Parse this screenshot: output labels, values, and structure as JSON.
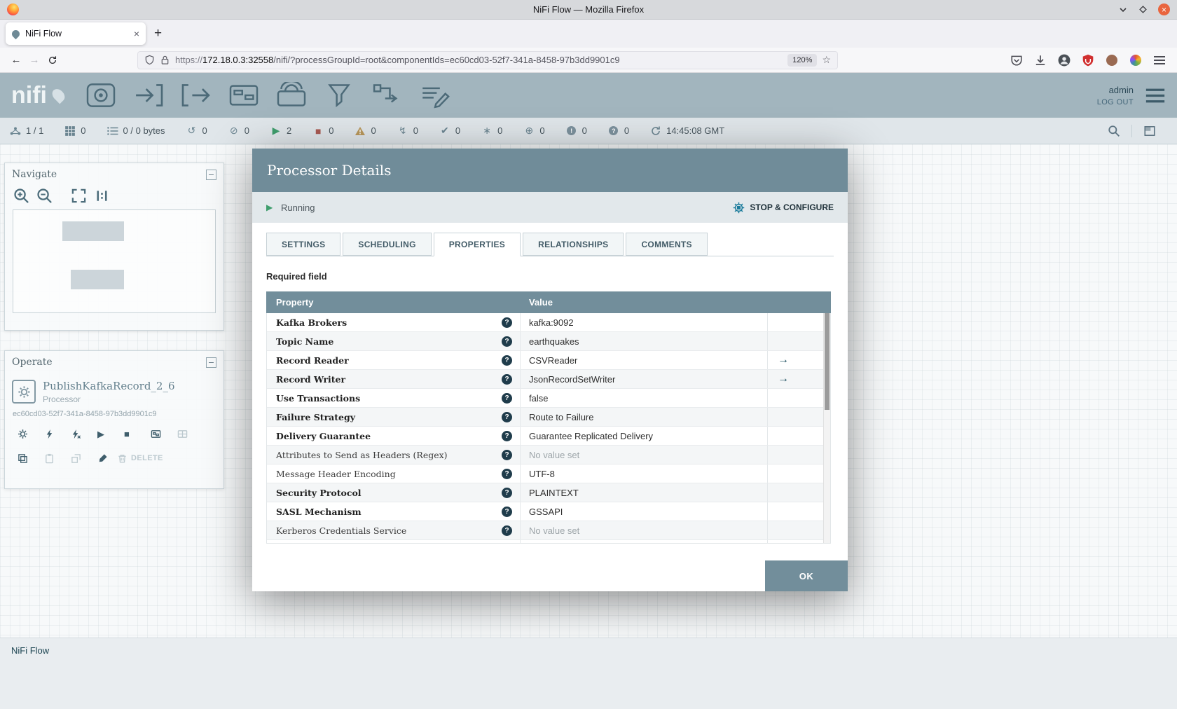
{
  "window": {
    "title": "NiFi Flow — Mozilla Firefox",
    "tab": {
      "title": "NiFi Flow"
    },
    "nav": {
      "urlbar": {
        "scheme": "https://",
        "host": "172.18.0.3:32558",
        "path": "/nifi/?processGroupId=root&componentIds=ec60cd03-52f7-341a-8458-97b3dd9901c9",
        "zoom": "120%"
      },
      "right_icons": [
        "pocket-icon",
        "downloads-icon",
        "account-icon",
        "ublock-icon",
        "extension-avatar-icon",
        "extension-pinwheel-icon",
        "menu-icon"
      ]
    }
  },
  "nifi": {
    "logo_text": "nifi",
    "toolbar": [
      {
        "name": "processor-component",
        "icon": "processor-icon"
      },
      {
        "name": "input-port-component",
        "icon": "input-port-icon"
      },
      {
        "name": "output-port-component",
        "icon": "output-port-icon"
      },
      {
        "name": "process-group-component",
        "icon": "process-group-icon"
      },
      {
        "name": "remote-process-group-component",
        "icon": "remote-process-group-icon"
      },
      {
        "name": "funnel-component",
        "icon": "funnel-icon"
      },
      {
        "name": "template-component",
        "icon": "template-icon"
      },
      {
        "name": "label-component",
        "icon": "label-icon"
      }
    ],
    "user": "admin",
    "logout_label": "LOG OUT",
    "statusbar": {
      "items": [
        {
          "name": "connected-nodes-count",
          "icon": "cluster-icon",
          "value": "1 / 1"
        },
        {
          "name": "active-threads-count",
          "icon": "threads-icon",
          "value": "0"
        },
        {
          "name": "queued-count",
          "icon": "queue-icon",
          "value": "0 / 0 bytes"
        },
        {
          "name": "transmitting-count",
          "icon": "transmitting-icon",
          "value": "0"
        },
        {
          "name": "not-transmitting-count",
          "icon": "not-transmitting-icon",
          "value": "0"
        },
        {
          "name": "running-count",
          "icon": "running-icon",
          "value": "2"
        },
        {
          "name": "stopped-count",
          "icon": "stopped-icon",
          "value": "0"
        },
        {
          "name": "invalid-count",
          "icon": "invalid-icon",
          "value": "0"
        },
        {
          "name": "disabled-count",
          "icon": "disabled-icon",
          "value": "0"
        },
        {
          "name": "up-to-date-count",
          "icon": "up-to-date-icon",
          "value": "0"
        },
        {
          "name": "locally-modified-count",
          "icon": "locally-modified-icon",
          "value": "0"
        },
        {
          "name": "stale-count",
          "icon": "stale-icon",
          "value": "0"
        },
        {
          "name": "locally-modified-stale-count",
          "icon": "locally-modified-stale-icon",
          "value": "0"
        },
        {
          "name": "sync-failure-count",
          "icon": "sync-failure-icon",
          "value": "0"
        },
        {
          "name": "last-refresh-time",
          "icon": "refresh-icon",
          "value": "14:45:08 GMT"
        }
      ]
    },
    "breadcrumb": "NiFi Flow"
  },
  "navigate_panel": {
    "title": "Navigate",
    "buttons": [
      {
        "name": "zoom-in-button",
        "icon": "zoom-in-icon"
      },
      {
        "name": "zoom-out-button",
        "icon": "zoom-out-icon"
      },
      {
        "name": "zoom-fit-button",
        "icon": "zoom-fit-icon"
      },
      {
        "name": "zoom-actual-button",
        "icon": "one-to-one-icon"
      }
    ]
  },
  "operate_panel": {
    "title": "Operate",
    "component_name": "PublishKafkaRecord_2_6",
    "component_type": "Processor",
    "component_id": "ec60cd03-52f7-341a-8458-97b3dd9901c9",
    "buttons_row1": [
      {
        "name": "configure-button",
        "icon": "gear-icon",
        "enabled": true
      },
      {
        "name": "enable-button",
        "icon": "bolt-icon",
        "enabled": true
      },
      {
        "name": "disable-button",
        "icon": "bolt-slash-icon",
        "enabled": true
      },
      {
        "name": "start-button",
        "icon": "play-icon",
        "enabled": true
      },
      {
        "name": "stop-button",
        "icon": "stop-icon",
        "enabled": true
      },
      {
        "name": "group-button",
        "icon": "group-icon",
        "enabled": true
      },
      {
        "name": "ungroup-button",
        "icon": "ungroup-icon",
        "enabled": false
      }
    ],
    "buttons_row2": [
      {
        "name": "copy-button",
        "icon": "copy-icon",
        "enabled": true
      },
      {
        "name": "paste-button",
        "icon": "paste-icon",
        "enabled": false
      },
      {
        "name": "move-to-front-button",
        "icon": "to-front-icon",
        "enabled": false
      },
      {
        "name": "change-color-button",
        "icon": "brush-icon",
        "enabled": true
      },
      {
        "name": "delete-button",
        "icon": "trash-icon",
        "enabled": false,
        "label": "DELETE"
      }
    ]
  },
  "dialog": {
    "title": "Processor Details",
    "status_label": "Running",
    "stop_configure_label": "STOP & CONFIGURE",
    "tabs": [
      {
        "label": "SETTINGS",
        "active": false
      },
      {
        "label": "SCHEDULING",
        "active": false
      },
      {
        "label": "PROPERTIES",
        "active": true
      },
      {
        "label": "RELATIONSHIPS",
        "active": false
      },
      {
        "label": "COMMENTS",
        "active": false
      }
    ],
    "required_field_label": "Required field",
    "table": {
      "property_header": "Property",
      "value_header": "Value",
      "rows": [
        {
          "name": "Kafka Brokers",
          "value": "kafka:9092",
          "required": true,
          "unset": false,
          "link": false
        },
        {
          "name": "Topic Name",
          "value": "earthquakes",
          "required": true,
          "unset": false,
          "link": false
        },
        {
          "name": "Record Reader",
          "value": "CSVReader",
          "required": true,
          "unset": false,
          "link": true
        },
        {
          "name": "Record Writer",
          "value": "JsonRecordSetWriter",
          "required": true,
          "unset": false,
          "link": true
        },
        {
          "name": "Use Transactions",
          "value": "false",
          "required": true,
          "unset": false,
          "link": false
        },
        {
          "name": "Failure Strategy",
          "value": "Route to Failure",
          "required": true,
          "unset": false,
          "link": false
        },
        {
          "name": "Delivery Guarantee",
          "value": "Guarantee Replicated Delivery",
          "required": true,
          "unset": false,
          "link": false
        },
        {
          "name": "Attributes to Send as Headers (Regex)",
          "value": "No value set",
          "required": false,
          "unset": true,
          "link": false
        },
        {
          "name": "Message Header Encoding",
          "value": "UTF-8",
          "required": false,
          "unset": false,
          "link": false
        },
        {
          "name": "Security Protocol",
          "value": "PLAINTEXT",
          "required": true,
          "unset": false,
          "link": false
        },
        {
          "name": "SASL Mechanism",
          "value": "GSSAPI",
          "required": true,
          "unset": false,
          "link": false
        },
        {
          "name": "Kerberos Credentials Service",
          "value": "No value set",
          "required": false,
          "unset": true,
          "link": false
        },
        {
          "name": "",
          "value": "",
          "required": false,
          "unset": false,
          "link": false
        }
      ]
    },
    "ok_label": "OK"
  },
  "colors": {
    "primary": "#728E9B",
    "running_green": "#3f9e6d",
    "stopped_red": "#aa5a52",
    "header_gray_teal": "#a2b5be"
  }
}
